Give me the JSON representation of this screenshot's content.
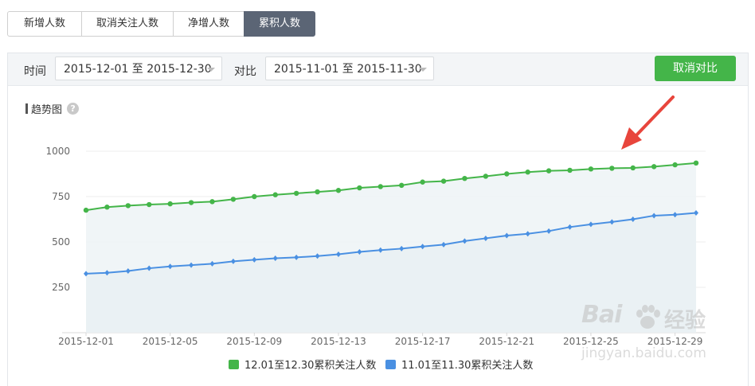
{
  "tabs": [
    {
      "label": "新增人数",
      "active": false
    },
    {
      "label": "取消关注人数",
      "active": false
    },
    {
      "label": "净增人数",
      "active": false
    },
    {
      "label": "累积人数",
      "active": true
    }
  ],
  "filter": {
    "time_label": "时间",
    "time_range": "2015-12-01 至 2015-12-30",
    "compare_label": "对比",
    "compare_range": "2015-11-01 至 2015-11-30",
    "cancel_compare_button": "取消对比"
  },
  "trend": {
    "title": "趋势图",
    "help_icon": "question-mark-icon"
  },
  "colors": {
    "green": "#44b549",
    "blue": "#4a90e2",
    "active_tab": "#5b6575",
    "arrow": "#e8453c"
  },
  "chart_data": {
    "type": "line",
    "x": [
      "2015-12-01",
      "2015-12-02",
      "2015-12-03",
      "2015-12-04",
      "2015-12-05",
      "2015-12-06",
      "2015-12-07",
      "2015-12-08",
      "2015-12-09",
      "2015-12-10",
      "2015-12-11",
      "2015-12-12",
      "2015-12-13",
      "2015-12-14",
      "2015-12-15",
      "2015-12-16",
      "2015-12-17",
      "2015-12-18",
      "2015-12-19",
      "2015-12-20",
      "2015-12-21",
      "2015-12-22",
      "2015-12-23",
      "2015-12-24",
      "2015-12-25",
      "2015-12-26",
      "2015-12-27",
      "2015-12-28",
      "2015-12-29",
      "2015-12-30"
    ],
    "x_tick_labels": [
      "2015-12-01",
      "2015-12-05",
      "2015-12-09",
      "2015-12-13",
      "2015-12-17",
      "2015-12-21",
      "2015-12-25",
      "2015-12-29"
    ],
    "y_ticks": [
      250,
      500,
      750,
      1000
    ],
    "ylim": [
      0,
      1050
    ],
    "grid": true,
    "legend_position": "bottom",
    "series": [
      {
        "name": "12.01至12.30累积关注人数",
        "color": "#44b549",
        "values": [
          675,
          692,
          700,
          706,
          710,
          717,
          722,
          735,
          750,
          760,
          768,
          776,
          784,
          798,
          805,
          812,
          830,
          835,
          850,
          862,
          875,
          885,
          892,
          895,
          902,
          906,
          908,
          915,
          925,
          935
        ]
      },
      {
        "name": "11.01至11.30累积关注人数",
        "color": "#4a90e2",
        "values": [
          325,
          330,
          340,
          355,
          365,
          372,
          380,
          393,
          402,
          410,
          415,
          422,
          432,
          445,
          455,
          463,
          475,
          485,
          505,
          520,
          535,
          545,
          560,
          582,
          597,
          610,
          625,
          645,
          650,
          660
        ]
      }
    ]
  },
  "watermark": {
    "brand": "Bai",
    "suffix": "经验",
    "url": "jingyan.baidu.com"
  }
}
